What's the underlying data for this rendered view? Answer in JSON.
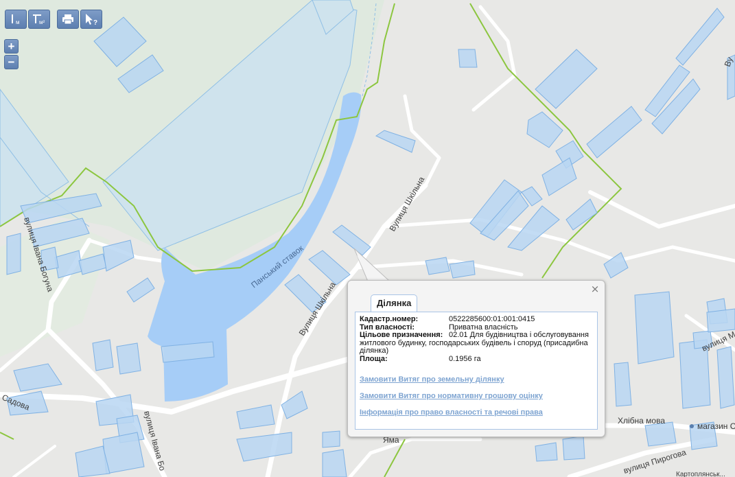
{
  "toolbar": {
    "buttons": [
      {
        "name": "measure-distance",
        "icon": "ruler-line-icon",
        "label": "м"
      },
      {
        "name": "measure-area",
        "icon": "ruler-area-icon",
        "label": "м²"
      },
      {
        "name": "print",
        "icon": "printer-icon",
        "label": ""
      },
      {
        "name": "identify",
        "icon": "cursor-question-icon",
        "label": "?"
      }
    ]
  },
  "zoom": {
    "in": "+",
    "out": "−"
  },
  "map_labels": {
    "water": "Панський ставок",
    "street_shkilna_1": "Вулиця Шкільна",
    "street_shkilna_2": "Вулиця Шкільна",
    "street_bohuna_1": "вулиця Івана Богуна",
    "street_bohuna_2": "вулиця Івана Бо",
    "street_sadova": "Садова",
    "street_pyrohova": "вулиця Пирогова",
    "street_right_1": "вулиця М",
    "street_top_right": "Ву",
    "poi_khlibna": "Хлібна мова",
    "poi_mahazyn": "магазин С",
    "poi_yama": "Яма",
    "bottom_right": "Картоплянськ..."
  },
  "colors": {
    "parcel_fill": "#b9d6f2",
    "parcel_stroke": "#7fb1e3",
    "water": "#a6cdf7",
    "boundary": "#8cc63f",
    "road": "#ffffff"
  },
  "popup": {
    "tab": "Ділянка",
    "close": "×",
    "fields": [
      {
        "label": "Кадастр.номер:",
        "value": "0522285600:01:001:0415"
      },
      {
        "label": "Тип власності:",
        "value": "Приватна власність"
      },
      {
        "label": "Цільове призначення:",
        "value": "02.01 Для будівництва і обслуговування"
      }
    ],
    "purpose_cont": "житлового будинку, господарських будівель і споруд (присадибна ділянка)",
    "area_label": "Площа:",
    "area_value": "0.1956 га",
    "links": [
      "Замовити Витяг про земельну ділянку",
      "Замовити Витяг про нормативну грошову оцінку",
      "Інформація про право власності та речові права"
    ]
  }
}
